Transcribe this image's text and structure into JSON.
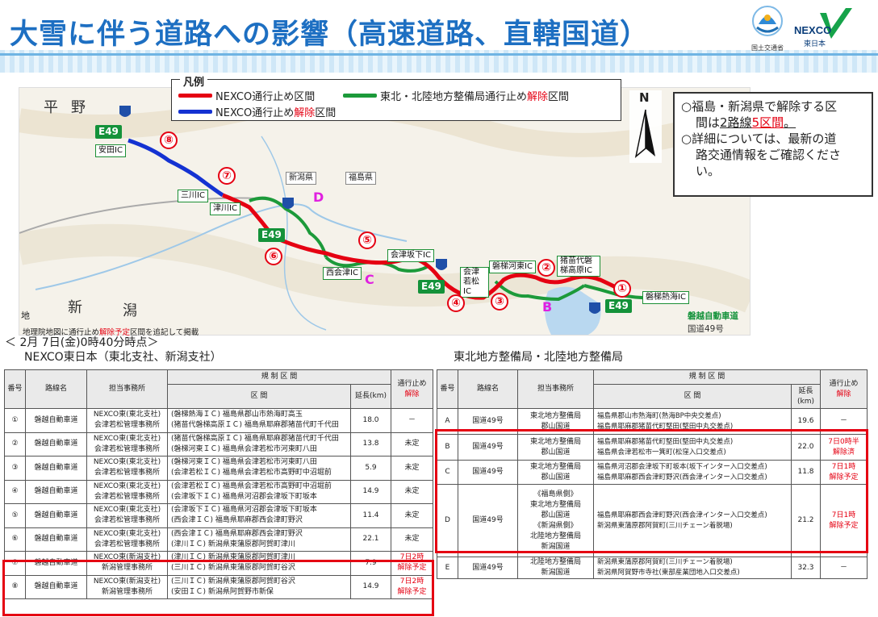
{
  "header": {
    "title": "大雪に伴う道路への影響（高速道路、直轄国道）",
    "logo_mlit_label": "国土交通省",
    "logo_nexco_label": "NEXCO",
    "logo_nexco_sub": "東日本"
  },
  "legend": {
    "title": "凡例",
    "item_closed": "NEXCO通行止め区間",
    "item_released_prefix": "NEXCO通行止め",
    "item_released_red": "解除",
    "item_released_suffix": "区間",
    "item_tohoku_prefix": "東北・北陸地方整備局通行止め",
    "item_tohoku_red": "解除",
    "item_tohoku_suffix": "区間",
    "colors": {
      "closed": "#e50012",
      "released": "#1432d2",
      "tohoku_released": "#1c9a3a"
    }
  },
  "north_label": "N",
  "note": {
    "line1": "○福島・新潟県で解除する区",
    "line2_a": "間は",
    "line2_b": "2路線",
    "line2_c": "5区間",
    "line2_d": "。",
    "line3": "○詳細については、最新の道",
    "line4": "路交通情報をご確認くださ",
    "line5": "い。"
  },
  "map": {
    "place_hira": "平",
    "place_no": "野",
    "place_shin": "新",
    "place_gata": "潟",
    "place_chi": "地",
    "pref_niigata": "新潟県",
    "pref_fukushima": "福島県",
    "ic_yasuda": "安田IC",
    "ic_sanjo": "三川IC",
    "ic_tsugawa": "津川IC",
    "ic_nishiaizu": "西会津IC",
    "ic_aizubange": "会津坂下IC",
    "ic_aizuwakamatsu": "会津若松IC",
    "ic_bandai_kawahigashi": "磐梯河東IC",
    "ic_inawashiro": "猪苗代磐梯高原IC",
    "ic_bandai_atami": "磐梯熱海IC",
    "e49": "E49",
    "n1": "①",
    "n2": "②",
    "n3": "③",
    "n4": "④",
    "n5": "⑤",
    "n6": "⑥",
    "n7": "⑦",
    "n8": "⑧",
    "lB": "B",
    "lC": "C",
    "lD": "D",
    "road_label": "磐越自動車道",
    "road_label2": "国道49号",
    "credit_a": "地理院地図に通行止め",
    "credit_red": "解除予定",
    "credit_b": "区間を追記して掲載"
  },
  "timestamp": "＜ 2月 7日(金)0時40分時点＞",
  "left": {
    "heading": "NEXCO東日本（東北支社、新潟支社）",
    "headers": {
      "no": "番号",
      "route": "路線名",
      "office": "担当事務所",
      "regulation": "規 制 区 間",
      "section": "区 間",
      "length": "延長(km)",
      "status_a": "通行止め",
      "status_b": "解除"
    },
    "rows": [
      {
        "no": "①",
        "route": "磐越自動車道",
        "office1": "NEXCO東(東北支社)",
        "office2": "会津若松管理事務所",
        "area1": "(磐梯熱海ＩＣ) 福島県郡山市熱海町高玉",
        "area2": "(猪苗代磐梯高原ＩＣ) 福島県耶麻郡猪苗代町千代田",
        "length": "18.0",
        "status1": "－",
        "status2": ""
      },
      {
        "no": "②",
        "route": "磐越自動車道",
        "office1": "NEXCO東(東北支社)",
        "office2": "会津若松管理事務所",
        "area1": "(猪苗代磐梯高原ＩＣ) 福島県耶麻郡猪苗代町千代田",
        "area2": "(磐梯河東ＩＣ) 福島県会津若松市河東町八田",
        "length": "13.8",
        "status1": "未定",
        "status2": ""
      },
      {
        "no": "③",
        "route": "磐越自動車道",
        "office1": "NEXCO東(東北支社)",
        "office2": "会津若松管理事務所",
        "area1": "(磐梯河東ＩＣ) 福島県会津若松市河東町八田",
        "area2": "(会津若松ＩＣ) 福島県会津若松市高野町中沼堀前",
        "length": "5.9",
        "status1": "未定",
        "status2": ""
      },
      {
        "no": "④",
        "route": "磐越自動車道",
        "office1": "NEXCO東(東北支社)",
        "office2": "会津若松管理事務所",
        "area1": "(会津若松ＩＣ) 福島県会津若松市高野町中沼堀前",
        "area2": "(会津坂下ＩＣ) 福島県河沼郡会津坂下町坂本",
        "length": "14.9",
        "status1": "未定",
        "status2": ""
      },
      {
        "no": "⑤",
        "route": "磐越自動車道",
        "office1": "NEXCO東(東北支社)",
        "office2": "会津若松管理事務所",
        "area1": "(会津坂下ＩＣ) 福島県河沼郡会津坂下町坂本",
        "area2": "(西会津ＩＣ) 福島県耶麻郡西会津町野沢",
        "length": "11.4",
        "status1": "未定",
        "status2": ""
      },
      {
        "no": "⑥",
        "route": "磐越自動車道",
        "office1": "NEXCO東(東北支社)",
        "office2": "会津若松管理事務所",
        "area1": "(西会津ＩＣ) 福島県耶麻郡西会津町野沢",
        "area2": "(津川ＩＣ) 新潟県東蒲原郡阿賀町津川",
        "length": "22.1",
        "status1": "未定",
        "status2": ""
      },
      {
        "no": "⑦",
        "route": "磐越自動車道",
        "office1": "NEXCO東(新潟支社)",
        "office2": "新潟管理事務所",
        "area1": "(津川ＩＣ) 新潟県東蒲原郡阿賀町津川",
        "area2": "(三川ＩＣ) 新潟県東蒲原郡阿賀町谷沢",
        "length": "7.9",
        "status1": "7日2時",
        "status2": "解除予定"
      },
      {
        "no": "⑧",
        "route": "磐越自動車道",
        "office1": "NEXCO東(新潟支社)",
        "office2": "新潟管理事務所",
        "area1": "(三川ＩＣ) 新潟県東蒲原郡阿賀町谷沢",
        "area2": "(安田ＩＣ) 新潟県阿賀野市新保",
        "length": "14.9",
        "status1": "7日2時",
        "status2": "解除予定"
      }
    ]
  },
  "right": {
    "heading": "東北地方整備局・北陸地方整備局",
    "headers": {
      "no": "番号",
      "route": "路線名",
      "office": "担当事務所",
      "regulation": "規 制 区 間",
      "section": "区 間",
      "length": "延長(km)",
      "status_a": "通行止め",
      "status_b": "解除"
    },
    "rows": [
      {
        "no": "A",
        "route": "国道49号",
        "office": [
          "東北地方整備局",
          "郡山国道"
        ],
        "area1": "福島県郡山市熱海町(熱海BP中央交差点)",
        "area2": "福島県耶麻郡猪苗代町堅田(堅田中丸交差点)",
        "length": "19.6",
        "status1": "－",
        "status2": ""
      },
      {
        "no": "B",
        "route": "国道49号",
        "office": [
          "東北地方整備局",
          "郡山国道"
        ],
        "area1": "福島県耶麻郡猪苗代町堅田(堅田中丸交差点)",
        "area2": "福島県会津若松市一箕町(松窪入口交差点)",
        "length": "22.0",
        "status1": "7日0時半",
        "status2": "解除済"
      },
      {
        "no": "C",
        "route": "国道49号",
        "office": [
          "東北地方整備局",
          "郡山国道"
        ],
        "area1": "福島県河沼郡会津坂下町坂本(坂下インター入口交差点)",
        "area2": "福島県耶麻郡西会津町野沢(西会津インター入口交差点)",
        "length": "11.8",
        "status1": "7日1時",
        "status2": "解除予定"
      },
      {
        "no": "D",
        "route": "国道49号",
        "office": [
          "《福島県側》",
          "東北地方整備局",
          "郡山国道",
          "《新潟県側》",
          "北陸地方整備局",
          "新潟国道"
        ],
        "area1": "福島県耶麻郡西会津町野沢(西会津インター入口交差点)",
        "area2": "新潟県東蒲原郡阿賀町(三川チェーン着脱場)",
        "length": "21.2",
        "status1": "7日1時",
        "status2": "解除予定"
      },
      {
        "no": "E",
        "route": "国道49号",
        "office": [
          "北陸地方整備局",
          "新潟国道"
        ],
        "area1": "新潟県東蒲原郡阿賀町(三川チェーン着脱場)",
        "area2": "新潟県阿賀野市寺社(東部産業団地入口交差点)",
        "length": "32.3",
        "status1": "－",
        "status2": ""
      }
    ]
  }
}
